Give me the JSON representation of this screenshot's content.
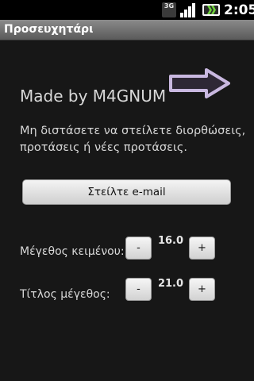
{
  "status_bar": {
    "network": "3G",
    "time": "2:05",
    "icons": [
      "3g-icon",
      "signal-icon",
      "battery-icon"
    ]
  },
  "title_bar": {
    "title": "Προσευχητάρι"
  },
  "about": {
    "made_by": "Made by M4GNUM",
    "message": "Μη διστάσετε να στείλετε διορθώσεις, προτάσεις ή νέες προτάσεις.",
    "arrow_icon": "arrow-right-icon"
  },
  "email_button": {
    "label": "Στείλτε e-mail"
  },
  "text_size": {
    "label": "Μέγεθος κειμένου:",
    "value": "16.0",
    "minus": "-",
    "plus": "+"
  },
  "title_size": {
    "label": "Τίτλος μέγεθος:",
    "value": "21.0",
    "minus": "-",
    "plus": "+"
  },
  "colors": {
    "background": "#171717",
    "text": "#d8d8d8",
    "arrow_fill": "#2e2735",
    "arrow_stroke": "#c9b8e0"
  }
}
